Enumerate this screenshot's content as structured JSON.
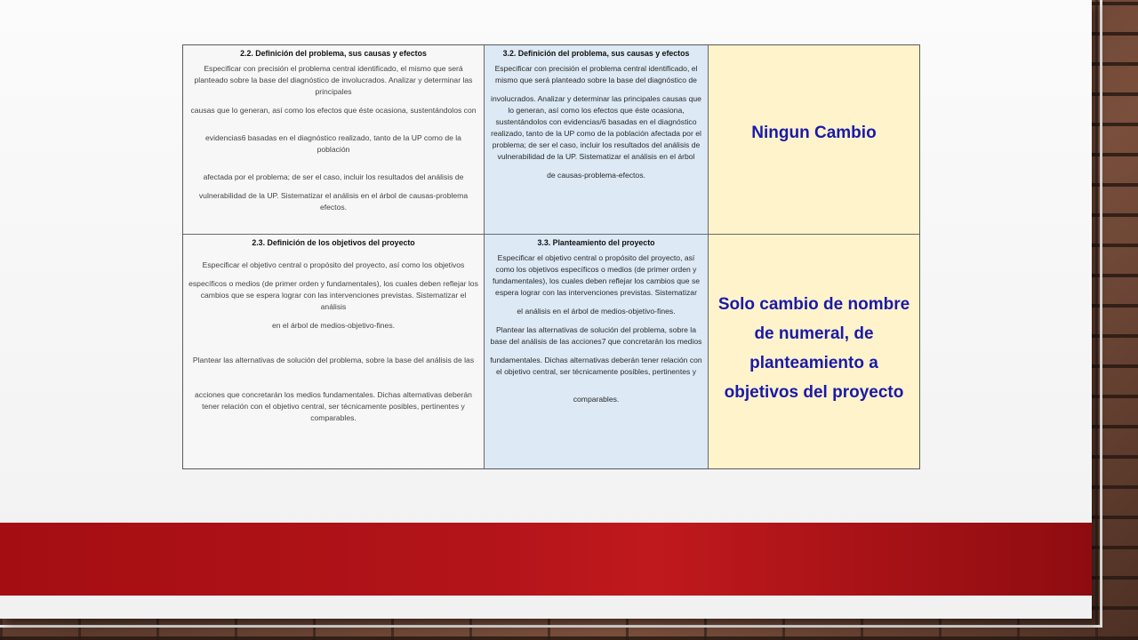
{
  "table": {
    "row1": {
      "left": {
        "heading": "2.2. Definición del problema, sus causas y efectos",
        "lines": [
          "Especificar con precisión el problema central identificado, el mismo que será planteado sobre la base del diagnóstico de involucrados. Analizar y determinar las principales",
          "causas que lo generan, así como los efectos que éste ocasiona, sustentándolos con",
          "evidencias6 basadas en el diagnóstico realizado, tanto de la UP como de la población",
          "afectada por el problema; de ser el caso, incluir los resultados del análisis de",
          "vulnerabilidad de la UP. Sistematizar el análisis en el árbol de causas-problema efectos."
        ]
      },
      "middle": {
        "heading": "3.2. Definición del problema, sus causas y efectos",
        "lines": [
          "Especificar con precisión el problema central identificado, el mismo que será planteado sobre la base del diagnóstico de",
          "involucrados. Analizar y determinar las principales causas que lo generan, así como los efectos que éste ocasiona, sustentándolos con evidencias/6 basadas en el diagnóstico realizado, tanto de la UP como de la población afectada por el problema; de ser el caso, incluir los resultados del análisis de vulnerabilidad de la UP. Sistematizar el análisis en el árbol",
          "de causas-problema-efectos."
        ]
      },
      "right": {
        "note": "Ningun Cambio"
      }
    },
    "row2": {
      "left": {
        "heading": "2.3. Definición de los objetivos del proyecto",
        "lines": [
          "Especificar el objetivo central o propósito del proyecto, así como los objetivos",
          "específicos o medios (de primer orden y fundamentales), los cuales deben reflejar los",
          "cambios que se espera lograr con las intervenciones previstas. Sistematizar el análisis",
          "en el árbol de medios-objetivo-fines.",
          "Plantear las alternativas de solución del problema, sobre la base del análisis de las",
          "acciones que concretarán los medios fundamentales. Dichas alternativas deberán tener relación con el objetivo central, ser técnicamente posibles, pertinentes y comparables."
        ]
      },
      "middle": {
        "heading": "3.3. Planteamiento del proyecto",
        "lines": [
          "Especificar el objetivo central o propósito del proyecto, así como los objetivos específicos o medios (de primer orden y fundamentales), los cuales deben reflejar los cambios que se espera lograr con las intervenciones previstas. Sistematizar",
          "el análisis en el árbol de medios-objetivo-fines.",
          "Plantear las alternativas de solución del problema, sobre la base del análisis de las acciones7 que concretarán los medios",
          "fundamentales. Dichas alternativas deberán tener relación con el objetivo central, ser técnicamente posibles, pertinentes y",
          "comparables."
        ]
      },
      "right": {
        "note": "Solo cambio de nombre de numeral, de planteamiento a objetivos del proyecto"
      }
    }
  },
  "colors": {
    "note_text": "#1a1aa8",
    "middle_column_bg": "#dde9f5",
    "right_column_bg": "#fff3cc",
    "band": "#b3141a"
  }
}
